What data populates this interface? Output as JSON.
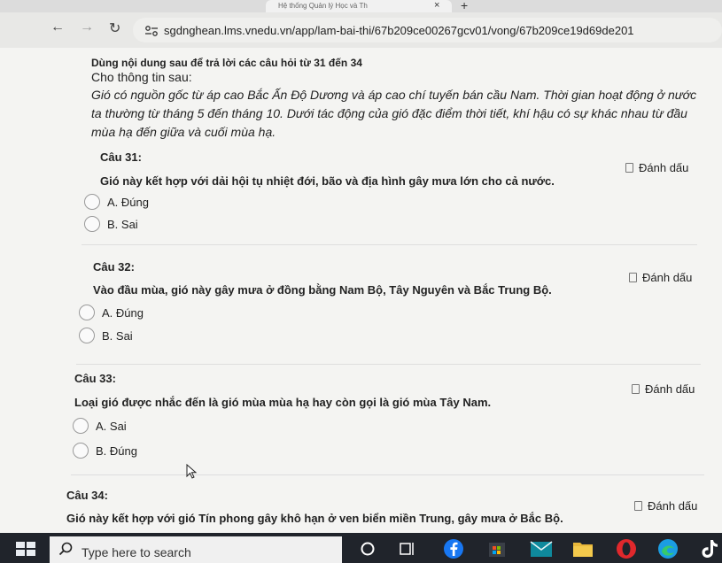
{
  "browser": {
    "tab_title": "Hệ thống Quản lý Học và Th",
    "tab_close": "×",
    "new_tab": "+",
    "url": "sgdnghean.lms.vnedu.vn/app/lam-bai-thi/67b209ce00267gcv01/vong/67b209ce19d69de201"
  },
  "intro": {
    "instruction": "Dùng nội dung sau để trả lời các câu hỏi từ 31 đến 34",
    "label": "Cho thông tin sau:",
    "passage": "Gió có nguồn gốc từ áp cao Bắc Ấn Độ Dương và áp cao chí tuyến bán cầu Nam. Thời gian hoạt động ở nước ta thường từ tháng 5 đến tháng 10. Dưới tác động của gió đặc điểm thời tiết, khí hậu có sự khác nhau từ đầu mùa hạ đến giữa và cuối mùa hạ."
  },
  "flag_label": "Đánh dấu",
  "questions": [
    {
      "title": "Câu 31:",
      "text": "Gió này kết hợp với dải hội tụ nhiệt đới, bão và địa hình gây mưa lớn cho cả nước.",
      "options": [
        "A. Đúng",
        "B. Sai"
      ]
    },
    {
      "title": "Câu 32:",
      "text": "Vào đầu mùa, gió này gây mưa ở đồng bằng Nam Bộ, Tây Nguyên và Bắc Trung Bộ.",
      "options": [
        "A. Đúng",
        "B. Sai"
      ]
    },
    {
      "title": "Câu 33:",
      "text": "Loại gió được nhắc đến là gió mùa mùa hạ hay còn gọi là gió mùa Tây Nam.",
      "options": [
        "A. Sai",
        "B. Đúng"
      ]
    },
    {
      "title": "Câu 34:",
      "text": "Gió này kết hợp với gió Tín phong gây khô hạn ở ven biển miền Trung, gây mưa ở Bắc Bộ.",
      "options": []
    }
  ],
  "taskbar": {
    "search_placeholder": "Type here to search"
  }
}
